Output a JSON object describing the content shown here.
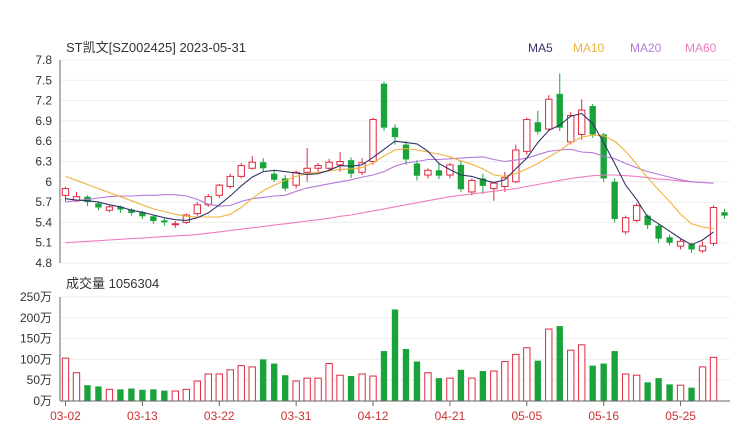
{
  "header": {
    "title": "ST凯文[SZ002425] 2023-05-31"
  },
  "volume_panel": {
    "label": "成交量 1056304"
  },
  "colors": {
    "up": "#e0293f",
    "down": "#1aa33b",
    "ma5": "#333366",
    "ma10": "#f0b23a",
    "ma20": "#b27adc",
    "ma60": "#f07cbe",
    "grid": "#eeeeee",
    "axis": "#666666"
  },
  "chart_data": [
    {
      "type": "candlestick",
      "legend": [
        "MA5",
        "MA10",
        "MA20",
        "MA60"
      ],
      "legend_position": "top-right",
      "ylim": [
        4.8,
        7.8
      ],
      "yticks": [
        "7.8",
        "7.5",
        "7.2",
        "6.9",
        "6.6",
        "6.3",
        "6",
        "5.7",
        "5.4",
        "5.1",
        "4.8"
      ],
      "xticks": [
        "03-02",
        "03-13",
        "03-22",
        "03-31",
        "04-12",
        "04-21",
        "05-05",
        "05-16",
        "05-25"
      ],
      "xtick_index": [
        0,
        7,
        14,
        21,
        28,
        35,
        42,
        49,
        56
      ],
      "candles": [
        [
          5.8,
          5.9,
          5.71,
          5.93
        ],
        [
          5.72,
          5.78,
          5.7,
          5.85
        ],
        [
          5.78,
          5.7,
          5.64,
          5.8
        ],
        [
          5.68,
          5.62,
          5.58,
          5.71
        ],
        [
          5.58,
          5.63,
          5.55,
          5.65
        ],
        [
          5.63,
          5.59,
          5.54,
          5.65
        ],
        [
          5.59,
          5.54,
          5.5,
          5.61
        ],
        [
          5.55,
          5.49,
          5.45,
          5.57
        ],
        [
          5.49,
          5.42,
          5.38,
          5.51
        ],
        [
          5.43,
          5.4,
          5.35,
          5.46
        ],
        [
          5.38,
          5.38,
          5.32,
          5.42
        ],
        [
          5.4,
          5.51,
          5.38,
          5.53
        ],
        [
          5.53,
          5.66,
          5.5,
          5.7
        ],
        [
          5.66,
          5.78,
          5.63,
          5.82
        ],
        [
          5.8,
          5.95,
          5.76,
          5.97
        ],
        [
          5.93,
          6.08,
          5.9,
          6.12
        ],
        [
          6.08,
          6.24,
          6.05,
          6.28
        ],
        [
          6.2,
          6.29,
          6.18,
          6.38
        ],
        [
          6.29,
          6.2,
          6.15,
          6.35
        ],
        [
          6.12,
          6.03,
          6.0,
          6.16
        ],
        [
          6.05,
          5.9,
          5.86,
          6.1
        ],
        [
          5.95,
          6.14,
          5.9,
          6.17
        ],
        [
          6.14,
          6.2,
          6.0,
          6.5
        ],
        [
          6.2,
          6.24,
          6.14,
          6.28
        ],
        [
          6.2,
          6.29,
          6.16,
          6.34
        ],
        [
          6.25,
          6.3,
          6.15,
          6.44
        ],
        [
          6.32,
          6.12,
          6.06,
          6.36
        ],
        [
          6.14,
          6.28,
          6.1,
          6.35
        ],
        [
          6.3,
          6.92,
          6.25,
          6.95
        ],
        [
          7.45,
          6.8,
          6.75,
          7.48
        ],
        [
          6.8,
          6.66,
          6.55,
          6.85
        ],
        [
          6.55,
          6.33,
          6.25,
          6.6
        ],
        [
          6.27,
          6.09,
          6.02,
          6.32
        ],
        [
          6.1,
          6.17,
          6.05,
          6.2
        ],
        [
          6.17,
          6.09,
          6.04,
          6.28
        ],
        [
          6.1,
          6.25,
          6.05,
          6.28
        ],
        [
          6.25,
          5.89,
          5.85,
          6.3
        ],
        [
          5.85,
          6.02,
          5.8,
          6.05
        ],
        [
          6.05,
          5.94,
          5.82,
          6.12
        ],
        [
          5.9,
          5.98,
          5.72,
          6.0
        ],
        [
          5.93,
          6.06,
          5.85,
          6.15
        ],
        [
          6.0,
          6.47,
          5.98,
          6.55
        ],
        [
          6.45,
          6.92,
          6.4,
          6.95
        ],
        [
          6.88,
          6.74,
          6.7,
          7.05
        ],
        [
          6.78,
          7.22,
          6.75,
          7.28
        ],
        [
          7.3,
          6.8,
          6.75,
          7.6
        ],
        [
          6.59,
          6.98,
          6.55,
          7.03
        ],
        [
          6.7,
          7.06,
          6.62,
          7.22
        ],
        [
          7.12,
          6.7,
          6.65,
          7.15
        ],
        [
          6.7,
          6.05,
          6.0,
          6.72
        ],
        [
          6.0,
          5.45,
          5.4,
          6.05
        ],
        [
          5.26,
          5.47,
          5.22,
          5.5
        ],
        [
          5.43,
          5.65,
          5.4,
          5.68
        ],
        [
          5.5,
          5.36,
          5.3,
          5.52
        ],
        [
          5.35,
          5.16,
          5.1,
          5.38
        ],
        [
          5.18,
          5.1,
          5.06,
          5.22
        ],
        [
          5.05,
          5.12,
          5.0,
          5.16
        ],
        [
          5.08,
          5.0,
          4.95,
          5.1
        ],
        [
          4.98,
          5.05,
          4.95,
          5.12
        ],
        [
          5.09,
          5.62,
          5.05,
          5.65
        ],
        [
          5.55,
          5.5,
          5.45,
          5.6
        ]
      ],
      "ma5": [
        5.75,
        5.73,
        5.72,
        5.7,
        5.66,
        5.63,
        5.58,
        5.55,
        5.51,
        5.47,
        5.44,
        5.43,
        5.47,
        5.54,
        5.66,
        5.79,
        5.94,
        6.07,
        6.15,
        6.17,
        6.15,
        6.13,
        6.11,
        6.12,
        6.17,
        6.24,
        6.23,
        6.25,
        6.36,
        6.48,
        6.6,
        6.58,
        6.56,
        6.45,
        6.27,
        6.18,
        6.1,
        6.08,
        6.03,
        5.99,
        6.03,
        6.19,
        6.35,
        6.58,
        6.76,
        6.84,
        6.97,
        7.01,
        6.86,
        6.58,
        6.27,
        5.95,
        5.74,
        5.48,
        5.38,
        5.27,
        5.16,
        5.07,
        5.14,
        5.26
      ],
      "ma10": [
        6.08,
        6.02,
        5.96,
        5.9,
        5.84,
        5.78,
        5.72,
        5.66,
        5.6,
        5.56,
        5.52,
        5.49,
        5.48,
        5.48,
        5.48,
        5.52,
        5.62,
        5.75,
        5.87,
        5.95,
        6.02,
        6.08,
        6.12,
        6.14,
        6.16,
        6.18,
        6.19,
        6.21,
        6.28,
        6.38,
        6.47,
        6.49,
        6.47,
        6.44,
        6.41,
        6.37,
        6.31,
        6.26,
        6.19,
        6.1,
        6.08,
        6.12,
        6.19,
        6.27,
        6.37,
        6.46,
        6.58,
        6.66,
        6.69,
        6.68,
        6.6,
        6.45,
        6.26,
        6.06,
        5.88,
        5.71,
        5.52,
        5.38,
        5.33,
        5.31
      ],
      "ma20": [
        5.7,
        5.72,
        5.74,
        5.76,
        5.78,
        5.79,
        5.79,
        5.8,
        5.8,
        5.81,
        5.81,
        5.79,
        5.74,
        5.67,
        5.64,
        5.65,
        5.71,
        5.75,
        5.77,
        5.79,
        5.8,
        5.86,
        5.91,
        5.94,
        5.97,
        6.0,
        6.03,
        6.07,
        6.1,
        6.15,
        6.23,
        6.28,
        6.3,
        6.33,
        6.33,
        6.34,
        6.35,
        6.36,
        6.37,
        6.33,
        6.3,
        6.32,
        6.35,
        6.4,
        6.45,
        6.47,
        6.48,
        6.44,
        6.43,
        6.38,
        6.34,
        6.27,
        6.21,
        6.15,
        6.11,
        6.07,
        6.03,
        6.0,
        5.99,
        5.98
      ],
      "ma60": [
        5.1,
        5.11,
        5.12,
        5.13,
        5.14,
        5.15,
        5.16,
        5.17,
        5.18,
        5.19,
        5.2,
        5.21,
        5.22,
        5.24,
        5.26,
        5.28,
        5.3,
        5.32,
        5.34,
        5.36,
        5.38,
        5.4,
        5.42,
        5.44,
        5.46,
        5.49,
        5.51,
        5.54,
        5.57,
        5.6,
        5.63,
        5.66,
        5.69,
        5.72,
        5.75,
        5.78,
        5.8,
        5.82,
        5.84,
        5.86,
        5.88,
        5.9,
        5.93,
        5.96,
        5.99,
        6.02,
        6.05,
        6.07,
        6.09,
        6.1,
        6.1,
        6.09,
        6.08,
        6.06,
        6.04,
        6.03,
        6.01,
        6.0,
        5.99,
        5.98
      ]
    },
    {
      "type": "bar",
      "ylim": [
        0,
        250
      ],
      "yticks": [
        "250万",
        "200万",
        "150万",
        "100万",
        "50万",
        "0万"
      ],
      "values": [
        103,
        68,
        38,
        35,
        28,
        28,
        30,
        27,
        28,
        25,
        24,
        28,
        48,
        65,
        65,
        75,
        85,
        82,
        100,
        90,
        62,
        48,
        55,
        55,
        90,
        62,
        60,
        65,
        60,
        120,
        220,
        125,
        95,
        68,
        55,
        55,
        75,
        55,
        72,
        72,
        95,
        112,
        128,
        97,
        173,
        180,
        122,
        135,
        85,
        90,
        120,
        65,
        62,
        45,
        55,
        40,
        38,
        32,
        82,
        105
      ]
    }
  ]
}
